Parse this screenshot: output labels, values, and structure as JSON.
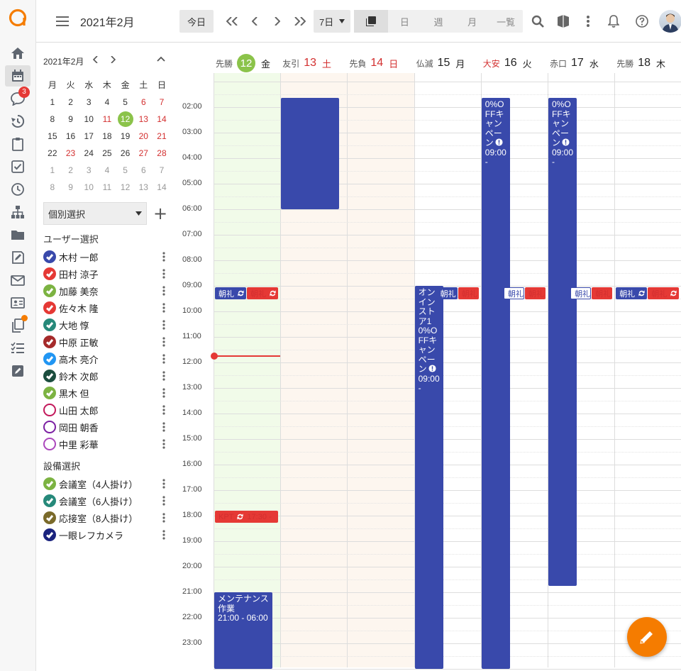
{
  "header": {
    "title": "2021年2月",
    "today_label": "今日",
    "range_select": "7日",
    "view_tabs": [
      "日",
      "週",
      "月",
      "一覧"
    ]
  },
  "rail": {
    "icons": [
      "home-icon",
      "calendar-icon",
      "chat-icon",
      "history-icon",
      "clipboard-icon",
      "checkbox-icon",
      "clock-icon",
      "org-chart-icon",
      "folder-icon",
      "edit-note-icon",
      "mail-icon",
      "contact-card-icon",
      "copy-icon",
      "task-list-icon",
      "pen-square-icon"
    ],
    "chat_badge": "3"
  },
  "mini_calendar": {
    "month_label": "2021年2月",
    "weekdays": [
      "月",
      "火",
      "水",
      "木",
      "金",
      "土",
      "日"
    ],
    "weeks": [
      [
        {
          "d": "1"
        },
        {
          "d": "2"
        },
        {
          "d": "3"
        },
        {
          "d": "4"
        },
        {
          "d": "5"
        },
        {
          "d": "6",
          "s": "red"
        },
        {
          "d": "7",
          "s": "red"
        }
      ],
      [
        {
          "d": "8"
        },
        {
          "d": "9"
        },
        {
          "d": "10"
        },
        {
          "d": "11",
          "s": "red"
        },
        {
          "d": "12",
          "s": "today"
        },
        {
          "d": "13",
          "s": "red"
        },
        {
          "d": "14",
          "s": "red"
        }
      ],
      [
        {
          "d": "15"
        },
        {
          "d": "16"
        },
        {
          "d": "17"
        },
        {
          "d": "18"
        },
        {
          "d": "19"
        },
        {
          "d": "20",
          "s": "red"
        },
        {
          "d": "21",
          "s": "red"
        }
      ],
      [
        {
          "d": "22"
        },
        {
          "d": "23",
          "s": "red"
        },
        {
          "d": "24"
        },
        {
          "d": "25"
        },
        {
          "d": "26"
        },
        {
          "d": "27",
          "s": "red"
        },
        {
          "d": "28",
          "s": "red"
        }
      ],
      [
        {
          "d": "1",
          "s": "gray"
        },
        {
          "d": "2",
          "s": "gray"
        },
        {
          "d": "3",
          "s": "gray"
        },
        {
          "d": "4",
          "s": "gray"
        },
        {
          "d": "5",
          "s": "gray"
        },
        {
          "d": "6",
          "s": "gray"
        },
        {
          "d": "7",
          "s": "gray"
        }
      ],
      [
        {
          "d": "8",
          "s": "gray"
        },
        {
          "d": "9",
          "s": "gray"
        },
        {
          "d": "10",
          "s": "gray"
        },
        {
          "d": "11",
          "s": "gray"
        },
        {
          "d": "12",
          "s": "gray"
        },
        {
          "d": "13",
          "s": "gray"
        },
        {
          "d": "14",
          "s": "gray"
        }
      ]
    ]
  },
  "panel": {
    "select_value": "個別選択",
    "users_heading": "ユーザー選択",
    "users": [
      {
        "name": "木村 一郎",
        "color": "#3949ab",
        "checked": true
      },
      {
        "name": "田村 涼子",
        "color": "#e53935",
        "checked": true
      },
      {
        "name": "加藤 美奈",
        "color": "#7cb342",
        "checked": true
      },
      {
        "name": "佐々木 隆",
        "color": "#e53935",
        "checked": true
      },
      {
        "name": "大地 惇",
        "color": "#26897a",
        "checked": true
      },
      {
        "name": "中原 正敏",
        "color": "#a52a2a",
        "checked": true
      },
      {
        "name": "高木 亮介",
        "color": "#2196f3",
        "checked": true
      },
      {
        "name": "鈴木 次郎",
        "color": "#1b4d3e",
        "checked": true
      },
      {
        "name": "黒木 但",
        "color": "#7cb342",
        "checked": true
      },
      {
        "name": "山田 太郎",
        "color": "#c2185b",
        "checked": false
      },
      {
        "name": "岡田 朝香",
        "color": "#7b1fa2",
        "checked": false
      },
      {
        "name": "中里 彩華",
        "color": "#ab47bc",
        "checked": false
      }
    ],
    "equipment_heading": "設備選択",
    "equipment": [
      {
        "name": "会議室（4人掛け）",
        "color": "#7cb342",
        "checked": true
      },
      {
        "name": "会議室（6人掛け）",
        "color": "#26897a",
        "checked": true
      },
      {
        "name": "応接室（8人掛け）",
        "color": "#7a6a2a",
        "checked": true
      },
      {
        "name": "一眼レフカメラ",
        "color": "#1a237e",
        "checked": true
      }
    ]
  },
  "days": [
    {
      "rokuyo": "先勝",
      "num": "12",
      "wd": "金",
      "today": true,
      "num_red": false,
      "wd_red": false,
      "rokuyo_red": false,
      "bg": "#f1fbe9"
    },
    {
      "rokuyo": "友引",
      "num": "13",
      "wd": "土",
      "today": false,
      "num_red": true,
      "wd_red": true,
      "rokuyo_red": false,
      "bg": "#fdf6ef"
    },
    {
      "rokuyo": "先負",
      "num": "14",
      "wd": "日",
      "today": false,
      "num_red": true,
      "wd_red": true,
      "rokuyo_red": false,
      "bg": "#fdf6ef"
    },
    {
      "rokuyo": "仏滅",
      "num": "15",
      "wd": "月",
      "today": false,
      "num_red": false,
      "wd_red": false,
      "rokuyo_red": false,
      "bg": "#ffffff"
    },
    {
      "rokuyo": "大安",
      "num": "16",
      "wd": "火",
      "today": false,
      "num_red": false,
      "wd_red": false,
      "rokuyo_red": true,
      "bg": "#ffffff"
    },
    {
      "rokuyo": "赤口",
      "num": "17",
      "wd": "水",
      "today": false,
      "num_red": false,
      "wd_red": false,
      "rokuyo_red": false,
      "bg": "#ffffff"
    },
    {
      "rokuyo": "先勝",
      "num": "18",
      "wd": "木",
      "today": false,
      "num_red": false,
      "wd_red": false,
      "rokuyo_red": false,
      "bg": "#ffffff"
    }
  ],
  "hours": [
    "02:00",
    "03:00",
    "04:00",
    "05:00",
    "06:00",
    "07:00",
    "08:00",
    "09:00",
    "10:00",
    "11:00",
    "12:00",
    "13:00",
    "14:00",
    "15:00",
    "16:00",
    "17:00",
    "18:00",
    "19:00",
    "20:00",
    "21:00",
    "22:00",
    "23:00"
  ],
  "events": [
    {
      "day": 1,
      "col": 0,
      "ncol": 1,
      "start": 1.65,
      "end": 6.0,
      "text": ""
    },
    {
      "day": 3,
      "col": 0,
      "ncol": 2,
      "start": 9.0,
      "end": 24.0,
      "text": "オンインストア10%OFFキャンペーン",
      "time": "09:00 -",
      "alert": true
    },
    {
      "day": 4,
      "col": 0,
      "ncol": 2,
      "start": 1.65,
      "end": 24.0,
      "text": "0%OFFキャンペーン",
      "time": "09:00 -",
      "alert": true
    },
    {
      "day": 5,
      "col": 0,
      "ncol": 2,
      "start": 1.65,
      "end": 20.75,
      "text": "0%OFFキャンペーン",
      "time": "09:00 -",
      "alert": true
    },
    {
      "day": 0,
      "col": 0,
      "ncol": 1,
      "start": 21.0,
      "end": 24.0,
      "text": "メンテナンス作業",
      "time": "21:00 - 06:00",
      "alert": false
    }
  ],
  "chips": [
    {
      "day": 0,
      "col": 0,
      "ncol": 2,
      "start": 9.0,
      "label": "朝礼",
      "style": "blue",
      "repeat": true
    },
    {
      "day": 0,
      "col": 1,
      "ncol": 2,
      "start": 9.0,
      "label": "朝礼",
      "style": "red",
      "repeat": true
    },
    {
      "day": 3,
      "col": 1,
      "ncol": 3,
      "start": 9.0,
      "label": "朝礼",
      "style": "blue",
      "repeat": false
    },
    {
      "day": 3,
      "col": 2,
      "ncol": 3,
      "start": 9.0,
      "label": "朝礼",
      "style": "red",
      "repeat": false
    },
    {
      "day": 4,
      "col": 1,
      "ncol": 3,
      "start": 9.0,
      "label": "朝礼",
      "style": "outline",
      "repeat": false
    },
    {
      "day": 4,
      "col": 2,
      "ncol": 3,
      "start": 9.0,
      "label": "朝礼",
      "style": "red",
      "repeat": false
    },
    {
      "day": 5,
      "col": 1,
      "ncol": 3,
      "start": 9.0,
      "label": "朝礼",
      "style": "outline",
      "repeat": false
    },
    {
      "day": 5,
      "col": 2,
      "ncol": 3,
      "start": 9.0,
      "label": "朝礼",
      "style": "red",
      "repeat": false
    },
    {
      "day": 6,
      "col": 0,
      "ncol": 2,
      "start": 9.0,
      "label": "朝礼",
      "style": "blue",
      "repeat": true
    },
    {
      "day": 6,
      "col": 1,
      "ncol": 2,
      "start": 9.0,
      "label": "朝礼",
      "style": "red",
      "repeat": true
    },
    {
      "day": 0,
      "col": 0,
      "ncol": 1,
      "start": 17.75,
      "label": "KPT",
      "style": "red",
      "repeat": true,
      "time": "17:30 -"
    }
  ],
  "now_time": 11.75,
  "colors": {
    "accent": "#f57c00",
    "event_blue": "#3949ab",
    "event_red": "#e53935",
    "today_green": "#8bc34a"
  }
}
